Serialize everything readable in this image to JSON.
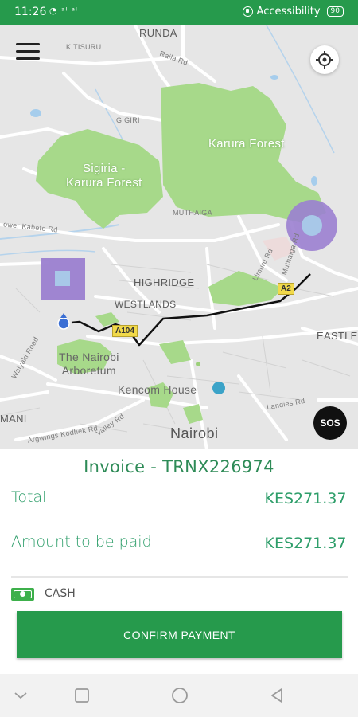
{
  "status_bar": {
    "time": "11:26",
    "indicators": "◔ ᵃˡ ᵃˡ",
    "accessibility_label": "Accessibility",
    "battery_level": "90"
  },
  "map": {
    "labels": {
      "runda": "RUNDA",
      "kitisuru": "KITISURU",
      "gigiri": "GIGIRI",
      "karura_forest": "Karura Forest",
      "sigiria_forest": "Sigiria -\nKarura Forest",
      "muthaiga": "MUTHAIGA",
      "highridge": "HIGHRIDGE",
      "westlands": "WESTLANDS",
      "eastleigh": "EASTLE",
      "arboretum": "The Nairobi\nArboretum",
      "kencom": "Kencom House",
      "nairobi": "Nairobi",
      "mani": "MANI",
      "road_a104": "A104",
      "road_a2": "A2",
      "raila_road": "Raila Rd",
      "kabete_rd": "ower Kabete Rd",
      "limuru_rd": "Limuru Rd",
      "muthaiga_rd": "Muthaiga Rd",
      "ngong_rd": "Argwings Kodhek Rd",
      "valley_rd": "Valley Rd",
      "landies_rd": "Landies Rd",
      "waiyaki_rd": "Waiyaki Road"
    },
    "sos_label": "SOS",
    "colors": {
      "route": "#111111",
      "marker": "#9b7fd0",
      "marker_inner": "#a8c8e8",
      "park": "#a7d98a",
      "current_location": "#3b6fd4"
    }
  },
  "invoice": {
    "title": "Invoice - TRNX226974",
    "total_label": "Total",
    "total_value": "KES271.37",
    "amount_label": "Amount to be paid",
    "amount_value": "KES271.37",
    "payment_method": "CASH",
    "confirm_label": "CONFIRM PAYMENT"
  },
  "nav": {
    "icons": [
      "back-chevron-icon",
      "recent-apps-icon",
      "home-icon",
      "back-triangle-icon"
    ]
  }
}
